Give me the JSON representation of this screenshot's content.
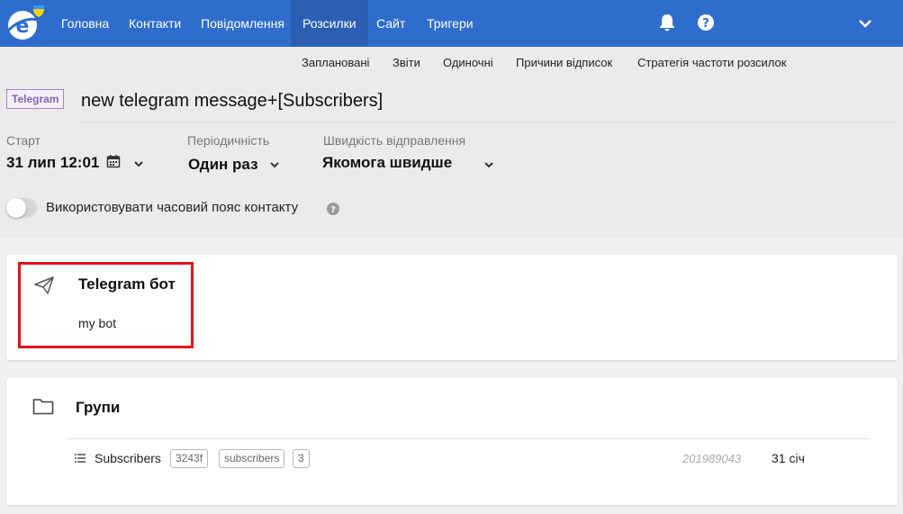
{
  "nav": {
    "items": [
      {
        "label": "Головна"
      },
      {
        "label": "Контакти"
      },
      {
        "label": "Повідомлення"
      },
      {
        "label": "Розсилки"
      },
      {
        "label": "Сайт"
      },
      {
        "label": "Тригери"
      }
    ],
    "active_index": 3,
    "accent_color": "#2f6dcc"
  },
  "subnav": {
    "items": [
      {
        "label": "Заплановані"
      },
      {
        "label": "Звіти"
      },
      {
        "label": "Одиночні"
      },
      {
        "label": "Причини відписок"
      },
      {
        "label": "Стратегія частоти розсилок"
      }
    ]
  },
  "header": {
    "channel_badge": "Telegram",
    "title": "new telegram message+[Subscribers]"
  },
  "settings": {
    "start": {
      "label": "Старт",
      "value": "31 лип 12:01"
    },
    "periodicity": {
      "label": "Періодичність",
      "value": "Один раз"
    },
    "speed": {
      "label": "Швидкість відправлення",
      "value": "Якомога швидше"
    },
    "timezone_toggle": {
      "label": "Використовувати часовий пояс контакту",
      "enabled": false
    }
  },
  "bot_card": {
    "title": "Telegram бот",
    "bot_name": "my bot",
    "icon": "paper-plane-icon"
  },
  "groups_card": {
    "title": "Групи",
    "icon": "folder-icon",
    "rows": [
      {
        "name": "Subscribers",
        "tags": [
          "3243f",
          "subscribers",
          "3"
        ],
        "id": "201989043",
        "date": "31 січ"
      }
    ]
  }
}
